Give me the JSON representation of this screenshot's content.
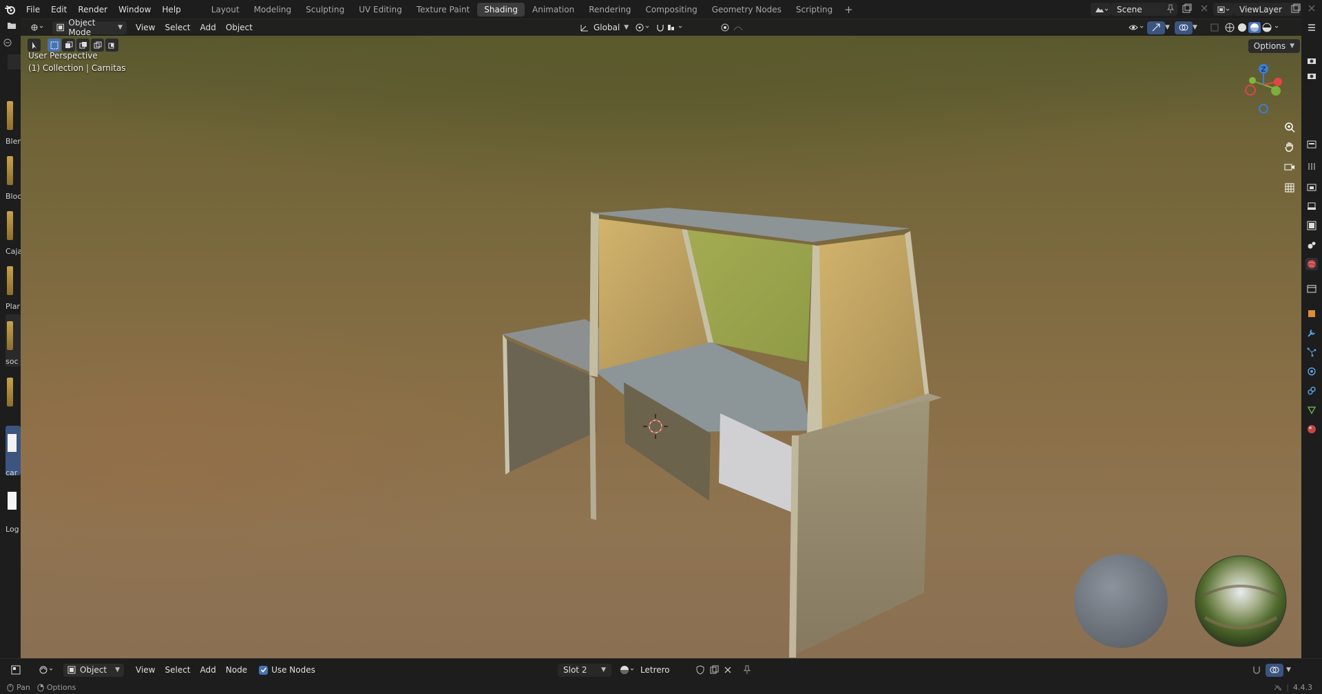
{
  "topbar": {
    "menus": [
      "File",
      "Edit",
      "Render",
      "Window",
      "Help"
    ],
    "workspaces": [
      "Layout",
      "Modeling",
      "Sculpting",
      "UV Editing",
      "Texture Paint",
      "Shading",
      "Animation",
      "Rendering",
      "Compositing",
      "Geometry Nodes",
      "Scripting"
    ],
    "active_workspace": "Shading",
    "add_workspace": "+",
    "scene": "Scene",
    "view_layer": "ViewLayer"
  },
  "left_panel": {
    "items": [
      {
        "label": "Blen"
      },
      {
        "label": "Bloc"
      },
      {
        "label": "Caja"
      },
      {
        "label": "Plar"
      },
      {
        "label": "soc"
      },
      {
        "label": ""
      },
      {
        "label": "car"
      },
      {
        "label": "Log"
      }
    ]
  },
  "viewport": {
    "mode": "Object Mode",
    "menus": [
      "View",
      "Select",
      "Add",
      "Object"
    ],
    "transform_orientation": "Global",
    "perspective": "User Perspective",
    "collection_info": "(1) Collection | Carnitas",
    "options": "Options",
    "gizmo_axes": {
      "x": "X",
      "y": "Y",
      "z": "Z"
    },
    "icons": [
      "select-box-icon",
      "gizmo-icon",
      "zoom-icon",
      "hand-icon",
      "camera-icon",
      "grid-icon"
    ]
  },
  "node_editor": {
    "type": "Object",
    "menus": [
      "View",
      "Select",
      "Add",
      "Node"
    ],
    "use_nodes_label": "Use Nodes",
    "use_nodes": true,
    "slot": "Slot 2",
    "material": "Letrero"
  },
  "statusbar": {
    "pan": "Pan",
    "options": "Options",
    "version": "4.4.3"
  },
  "colors": {
    "accent": "#4772b3",
    "header": "#1d1d1d",
    "x_axis": "#e04646",
    "y_axis": "#7fb63e",
    "z_axis": "#3a7fd6"
  }
}
